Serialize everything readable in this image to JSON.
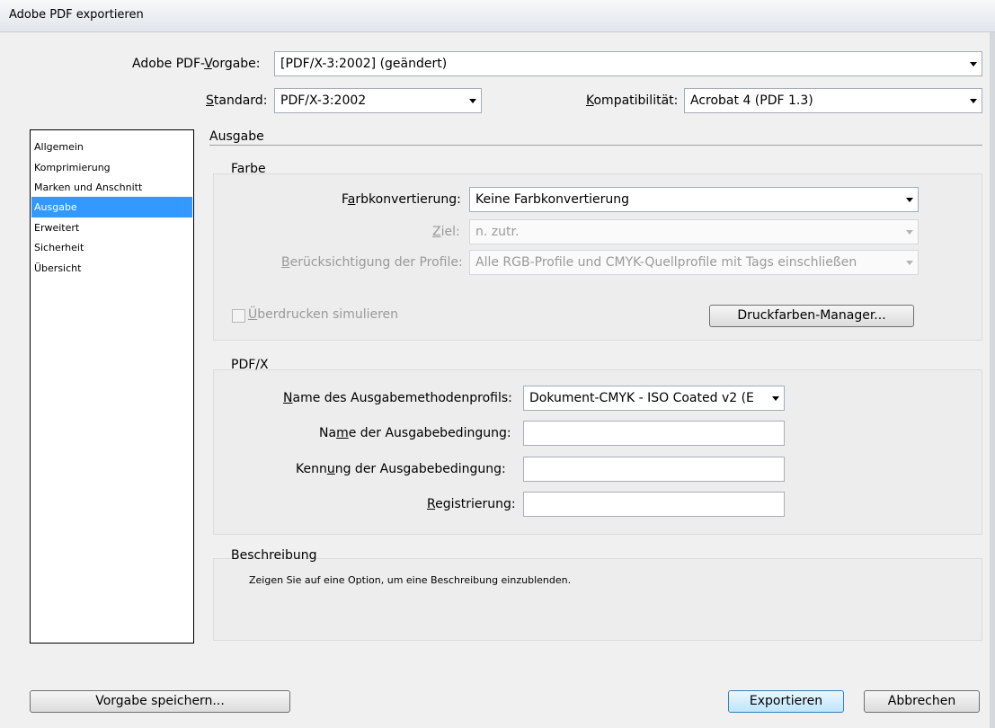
{
  "window": {
    "title": "Adobe PDF exportieren"
  },
  "header": {
    "preset": {
      "label_pre": "Adobe PDF-",
      "label_u": "V",
      "label_post": "orgabe:",
      "value": "[PDF/X-3:2002] (geändert)"
    },
    "standard": {
      "label_u": "S",
      "label_post": "tandard:",
      "value": "PDF/X-3:2002"
    },
    "compat": {
      "label_u": "K",
      "label_post": "ompatibilität:",
      "value": "Acrobat 4 (PDF 1.3)"
    }
  },
  "sidebar": {
    "items": [
      {
        "label": "Allgemein"
      },
      {
        "label": "Komprimierung"
      },
      {
        "label": "Marken und Anschnitt"
      },
      {
        "label": "Ausgabe"
      },
      {
        "label": "Erweitert"
      },
      {
        "label": "Sicherheit"
      },
      {
        "label": "Übersicht"
      }
    ],
    "selected_index": 3
  },
  "section": {
    "title": "Ausgabe"
  },
  "farbe": {
    "title": "Farbe",
    "conversion": {
      "label_pre": "F",
      "label_u": "a",
      "label_post": "rbkonvertierung:",
      "value": "Keine Farbkonvertierung"
    },
    "target": {
      "label_u": "Z",
      "label_post": "iel:",
      "value": "n. zutr."
    },
    "profiles": {
      "label_u": "B",
      "label_post": "erücksichtigung der Profile:",
      "value": "Alle RGB-Profile und CMYK-Quellprofile mit Tags einschließen"
    },
    "overprint": {
      "label_u": "Ü",
      "label_post": "berdrucken simulieren",
      "checked": false
    },
    "ink_manager_button": "Druckfarben-Manager..."
  },
  "pdfx": {
    "title": "PDF/X",
    "profile_name": {
      "label_u": "N",
      "label_post": "ame des Ausgabemethodenprofils:",
      "value": "Dokument-CMYK - ISO Coated v2 (E"
    },
    "condition_name": {
      "label_pre": "Na",
      "label_u": "m",
      "label_post": "e der Ausgabebedingung:",
      "value": ""
    },
    "condition_id": {
      "label_pre": "Kenn",
      "label_u": "u",
      "label_post": "ng der Ausgabebedingung:",
      "value": ""
    },
    "registry": {
      "label_u": "R",
      "label_post": "egistrierung:",
      "value": ""
    }
  },
  "description": {
    "title": "Beschreibung",
    "text": "Zeigen Sie auf eine Option, um eine Beschreibung einzublenden."
  },
  "footer": {
    "save_preset": "Vorgabe speichern...",
    "export": "Exportieren",
    "cancel": "Abbrechen"
  }
}
